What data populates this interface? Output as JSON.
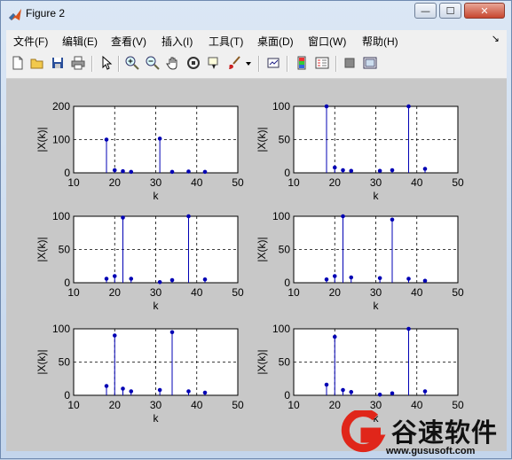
{
  "window": {
    "title": "Figure 2",
    "minimize_label": "—",
    "maximize_label": "☐",
    "close_label": "✕"
  },
  "menu": [
    {
      "label": "文件(F)"
    },
    {
      "label": "编辑(E)"
    },
    {
      "label": "查看(V)"
    },
    {
      "label": "插入(I)"
    },
    {
      "label": "工具(T)"
    },
    {
      "label": "桌面(D)"
    },
    {
      "label": "窗口(W)"
    },
    {
      "label": "帮助(H)"
    }
  ],
  "menu_extra": "↘",
  "toolbar": [
    {
      "icon": "new-figure-icon"
    },
    {
      "icon": "open-icon"
    },
    {
      "icon": "save-icon"
    },
    {
      "icon": "print-icon"
    },
    {
      "icon": "edit-pointer-icon"
    },
    {
      "icon": "zoom-in-icon"
    },
    {
      "icon": "zoom-out-icon"
    },
    {
      "icon": "pan-icon"
    },
    {
      "icon": "rotate-3d-icon"
    },
    {
      "icon": "data-cursor-icon"
    },
    {
      "icon": "brush-icon"
    },
    {
      "icon": "dropdown-icon"
    },
    {
      "icon": "link-plot-icon"
    },
    {
      "icon": "colorbar-icon"
    },
    {
      "icon": "legend-icon"
    },
    {
      "icon": "hide-plot-tools-icon"
    },
    {
      "icon": "show-plot-tools-icon"
    }
  ],
  "chart_data": [
    {
      "type": "stem",
      "xlabel": "k",
      "ylabel": "|X(k)|",
      "xlim": [
        10,
        50
      ],
      "ylim": [
        0,
        200
      ],
      "xticks": [
        "10",
        "20",
        "30",
        "40",
        "50"
      ],
      "yticks": [
        "0",
        "100",
        "200"
      ],
      "grid": true,
      "x": [
        18,
        20,
        22,
        24,
        31,
        34,
        38,
        42
      ],
      "y": [
        100,
        8,
        5,
        3,
        103,
        3,
        4,
        3
      ]
    },
    {
      "type": "stem",
      "xlabel": "k",
      "ylabel": "|X(k)|",
      "xlim": [
        10,
        50
      ],
      "ylim": [
        0,
        100
      ],
      "xticks": [
        "10",
        "20",
        "30",
        "40",
        "50"
      ],
      "yticks": [
        "0",
        "50",
        "100"
      ],
      "grid": true,
      "x": [
        18,
        20,
        22,
        24,
        31,
        34,
        38,
        42
      ],
      "y": [
        100,
        8,
        4,
        3,
        3,
        4,
        100,
        6
      ]
    },
    {
      "type": "stem",
      "xlabel": "k",
      "ylabel": "|X(k)|",
      "xlim": [
        10,
        50
      ],
      "ylim": [
        0,
        100
      ],
      "xticks": [
        "10",
        "20",
        "30",
        "40",
        "50"
      ],
      "yticks": [
        "0",
        "50",
        "100"
      ],
      "grid": true,
      "x": [
        18,
        20,
        22,
        24,
        31,
        34,
        38,
        42
      ],
      "y": [
        6,
        10,
        98,
        6,
        1,
        4,
        100,
        5
      ]
    },
    {
      "type": "stem",
      "xlabel": "k",
      "ylabel": "|X(k)|",
      "xlim": [
        10,
        50
      ],
      "ylim": [
        0,
        100
      ],
      "xticks": [
        "10",
        "20",
        "30",
        "40",
        "50"
      ],
      "yticks": [
        "0",
        "50",
        "100"
      ],
      "grid": true,
      "x": [
        18,
        20,
        22,
        24,
        31,
        34,
        38,
        42
      ],
      "y": [
        5,
        10,
        100,
        8,
        7,
        95,
        6,
        3
      ]
    },
    {
      "type": "stem",
      "xlabel": "k",
      "ylabel": "|X(k)|",
      "xlim": [
        10,
        50
      ],
      "ylim": [
        0,
        100
      ],
      "xticks": [
        "10",
        "20",
        "30",
        "40",
        "50"
      ],
      "yticks": [
        "0",
        "50",
        "100"
      ],
      "grid": true,
      "x": [
        18,
        20,
        22,
        24,
        31,
        34,
        38,
        42
      ],
      "y": [
        14,
        90,
        10,
        6,
        8,
        95,
        6,
        4
      ]
    },
    {
      "type": "stem",
      "xlabel": "k",
      "ylabel": "|X(k)|",
      "xlim": [
        10,
        50
      ],
      "ylim": [
        0,
        100
      ],
      "xticks": [
        "10",
        "20",
        "30",
        "40",
        "50"
      ],
      "yticks": [
        "0",
        "50",
        "100"
      ],
      "grid": true,
      "x": [
        18,
        20,
        22,
        24,
        31,
        34,
        38,
        42
      ],
      "y": [
        16,
        88,
        8,
        5,
        1,
        3,
        100,
        6
      ]
    }
  ],
  "colors": {
    "stem": "#0000b4",
    "figure_bg": "#c8c8c8",
    "axes_bg": "#ffffff",
    "watermark_red": "#e0261a"
  },
  "watermark": {
    "name": "谷速软件",
    "url": "www.gususoft.com"
  }
}
